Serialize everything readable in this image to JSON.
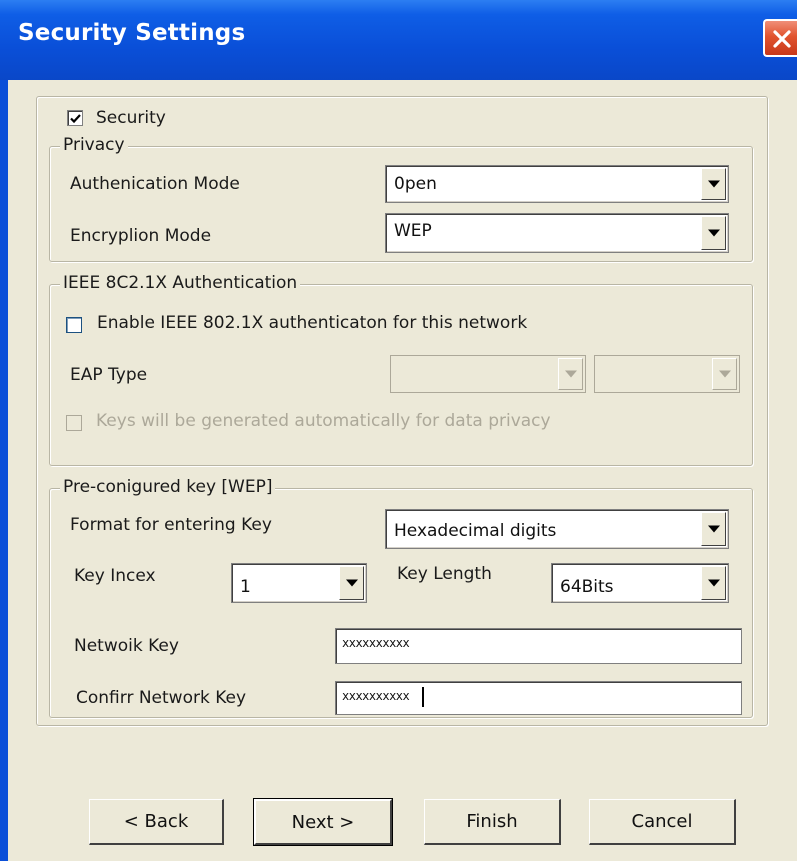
{
  "window": {
    "title": "Security Settings"
  },
  "security": {
    "checkbox_label": "Security",
    "checked": true
  },
  "privacy": {
    "legend": "Privacy",
    "auth_mode_label": "Authenication Mode",
    "auth_mode_value": "0pen",
    "encryption_mode_label": "Encryplion Mode",
    "encryption_mode_value": "WEP"
  },
  "ieee": {
    "legend": "IEEE 8C2.1X Authentication",
    "enable_label": "Enable IEEE 802.1X authenticaton for this network",
    "enable_checked": false,
    "eap_type_label": "EAP Type",
    "keys_label": "Keys will be generated automatically for data privacy",
    "keys_checked": false
  },
  "wep": {
    "legend": "Pre-conigured key [WEP]",
    "format_label": "Format for entering Key",
    "format_value": "Hexadecimal digits",
    "key_index_label": "Key Incex",
    "key_index_value": "1",
    "key_length_label": "Key Length",
    "key_length_value": "64Bits",
    "network_key_label": "Netwoik Key",
    "network_key_value": "xxxxxxxxxx",
    "confirm_key_label": "Confirr Network Key",
    "confirm_key_value": "xxxxxxxxxx"
  },
  "buttons": {
    "back": "< Back",
    "next": "Next >",
    "finish": "Finish",
    "cancel": "Cancel"
  }
}
